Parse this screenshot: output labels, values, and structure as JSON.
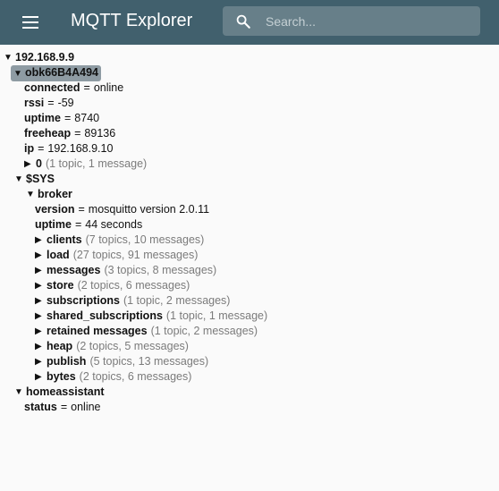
{
  "appbar": {
    "title": "MQTT Explorer",
    "search_placeholder": "Search...",
    "color": "#41606d"
  },
  "icons": {
    "menu": "menu-icon",
    "search": "search-icon",
    "expanded": "▼",
    "collapsed": "▶"
  },
  "tree": {
    "root": {
      "label": "192.168.9.9"
    },
    "device": {
      "label": "obk66B4A494",
      "attrs": [
        {
          "key": "connected",
          "value": "online"
        },
        {
          "key": "rssi",
          "value": "-59"
        },
        {
          "key": "uptime",
          "value": "8740"
        },
        {
          "key": "freeheap",
          "value": "89136"
        },
        {
          "key": "ip",
          "value": "192.168.9.10"
        }
      ],
      "child": {
        "label": "0",
        "meta": "(1 topic, 1 message)"
      }
    },
    "sys": {
      "label": "$SYS",
      "broker": {
        "label": "broker",
        "attrs": [
          {
            "key": "version",
            "value": "mosquitto version 2.0.11"
          },
          {
            "key": "uptime",
            "value": "44 seconds"
          }
        ],
        "children": [
          {
            "label": "clients",
            "meta": "(7 topics, 10 messages)"
          },
          {
            "label": "load",
            "meta": "(27 topics, 91 messages)"
          },
          {
            "label": "messages",
            "meta": "(3 topics, 8 messages)"
          },
          {
            "label": "store",
            "meta": "(2 topics, 6 messages)"
          },
          {
            "label": "subscriptions",
            "meta": "(1 topic, 2 messages)"
          },
          {
            "label": "shared_subscriptions",
            "meta": "(1 topic, 1 message)"
          },
          {
            "label": "retained messages",
            "meta": "(1 topic, 2 messages)"
          },
          {
            "label": "heap",
            "meta": "(2 topics, 5 messages)"
          },
          {
            "label": "publish",
            "meta": "(5 topics, 13 messages)"
          },
          {
            "label": "bytes",
            "meta": "(2 topics, 6 messages)"
          }
        ]
      }
    },
    "homeassistant": {
      "label": "homeassistant",
      "attrs": [
        {
          "key": "status",
          "value": "online"
        }
      ]
    }
  }
}
